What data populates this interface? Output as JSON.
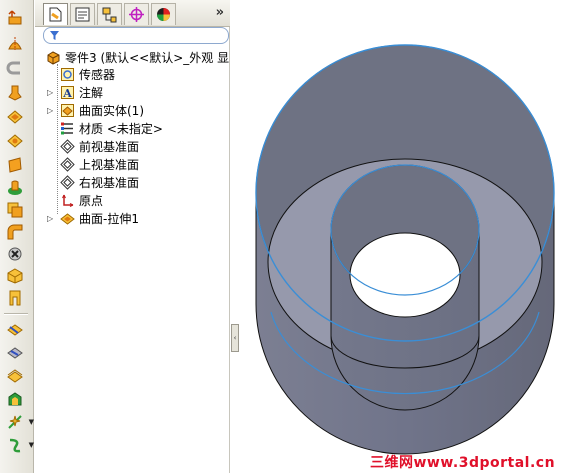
{
  "left_toolbar": {
    "tools": [
      {
        "icon": "extruded-boss-icon"
      },
      {
        "icon": "revolved-boss-icon"
      },
      {
        "icon": "magnet-icon"
      },
      {
        "icon": "loft-icon"
      },
      {
        "icon": "extruded-surface-icon"
      },
      {
        "icon": "revolved-surface-icon"
      },
      {
        "icon": "planar-surface-icon"
      },
      {
        "icon": "boundary-surface-icon"
      },
      {
        "icon": "offset-surface-icon"
      },
      {
        "icon": "fillet-surface-icon"
      },
      {
        "icon": "delete-face-icon"
      },
      {
        "icon": "replace-face-icon"
      },
      {
        "icon": "untrim-surface-icon"
      },
      {
        "icon": "knit-surface-icon"
      },
      {
        "icon": "trim-surface-icon"
      },
      {
        "icon": "thicken-icon"
      },
      {
        "icon": "fill-surface-icon"
      },
      {
        "icon": "reference-geometry-icon"
      },
      {
        "icon": "curves-icon"
      }
    ]
  },
  "panel": {
    "tabs": [
      {
        "icon": "feature-manager-icon",
        "active": true
      },
      {
        "icon": "property-manager-icon",
        "active": false
      },
      {
        "icon": "configuration-manager-icon",
        "active": false
      },
      {
        "icon": "dimxpert-icon",
        "active": false
      },
      {
        "icon": "display-manager-icon",
        "active": false
      }
    ],
    "expand_glyph": "»",
    "tree": [
      {
        "label": "零件3 (默认<<默认>_外观 显",
        "icon": "part-icon",
        "expandable": false
      },
      {
        "label": "传感器",
        "icon": "sensor-icon",
        "expandable": false
      },
      {
        "label": "注解",
        "icon": "annotation-icon",
        "expandable": true
      },
      {
        "label": "曲面实体(1)",
        "icon": "surface-body-icon",
        "expandable": true
      },
      {
        "label": "材质 <未指定>",
        "icon": "material-icon",
        "expandable": false
      },
      {
        "label": "前视基准面",
        "icon": "plane-icon",
        "expandable": false
      },
      {
        "label": "上视基准面",
        "icon": "plane-icon",
        "expandable": false
      },
      {
        "label": "右视基准面",
        "icon": "plane-icon",
        "expandable": false
      },
      {
        "label": "原点",
        "icon": "origin-icon",
        "expandable": false
      },
      {
        "label": "曲面-拉伸1",
        "icon": "extruded-surface-feature-icon",
        "expandable": true
      }
    ]
  },
  "splitter_glyph": "‹",
  "colors": {
    "surface_dark": "#6e7283",
    "surface_light": "#9699ac",
    "edge_highlight": "#3a8ed6"
  },
  "watermark": "三维网www.3dportal.cn"
}
